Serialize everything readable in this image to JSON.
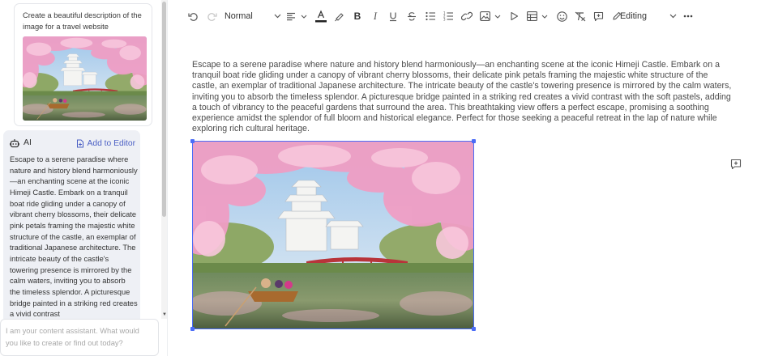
{
  "chat": {
    "user_message": "Create a beautiful description of the image for a travel website",
    "ai_label": "AI",
    "add_to_editor_label": "Add to Editor",
    "ai_response": "Escape to a serene paradise where nature and history blend harmoniously—an enchanting scene at the iconic Himeji Castle. Embark on a tranquil boat ride gliding under a canopy of vibrant cherry blossoms, their delicate pink petals framing the majestic white structure of the castle, an exemplar of traditional Japanese architecture. The intricate beauty of the castle's towering presence is mirrored by the calm waters, inviting you to absorb the timeless splendor. A picturesque bridge painted in a striking red creates a vivid contrast",
    "input_placeholder": "I am your content assistant. What would you like to create or find out today?"
  },
  "toolbar": {
    "block_style": "Normal",
    "mode": "Editing",
    "icons": [
      "undo-icon",
      "redo-icon",
      "paragraph-style-dropdown",
      "align-icon",
      "font-color-icon",
      "highlight-icon",
      "bold-icon",
      "italic-icon",
      "underline-icon",
      "strikethrough-icon",
      "bulleted-list-icon",
      "numbered-list-icon",
      "link-icon",
      "image-icon",
      "media-icon",
      "table-icon",
      "emoji-icon",
      "clear-format-icon",
      "comment-icon",
      "pencil-icon",
      "more-icon"
    ],
    "font_color_underline": "#222222"
  },
  "editor": {
    "paragraph": "Escape to a serene paradise where nature and history blend harmoniously—an enchanting scene at the iconic Himeji Castle. Embark on a tranquil boat ride gliding under a canopy of vibrant cherry blossoms, their delicate pink petals framing the majestic white structure of the castle, an exemplar of traditional Japanese architecture. The intricate beauty of the castle's towering presence is mirrored by the calm waters, inviting you to absorb the timeless splendor. A picturesque bridge painted in a striking red creates a vivid contrast with the soft pastels, adding a touch of vibrancy to the peaceful gardens that surround the area. This breathtaking view offers a perfect escape, promising a soothing experience amidst the splendor of full bloom and historical elegance. Perfect for those seeking a peaceful retreat in the lap of nature while exploring rich cultural heritage."
  },
  "colors": {
    "accent": "#4a6cf7",
    "link": "#4b5fc4",
    "ai_bubble": "#eef0f5"
  }
}
